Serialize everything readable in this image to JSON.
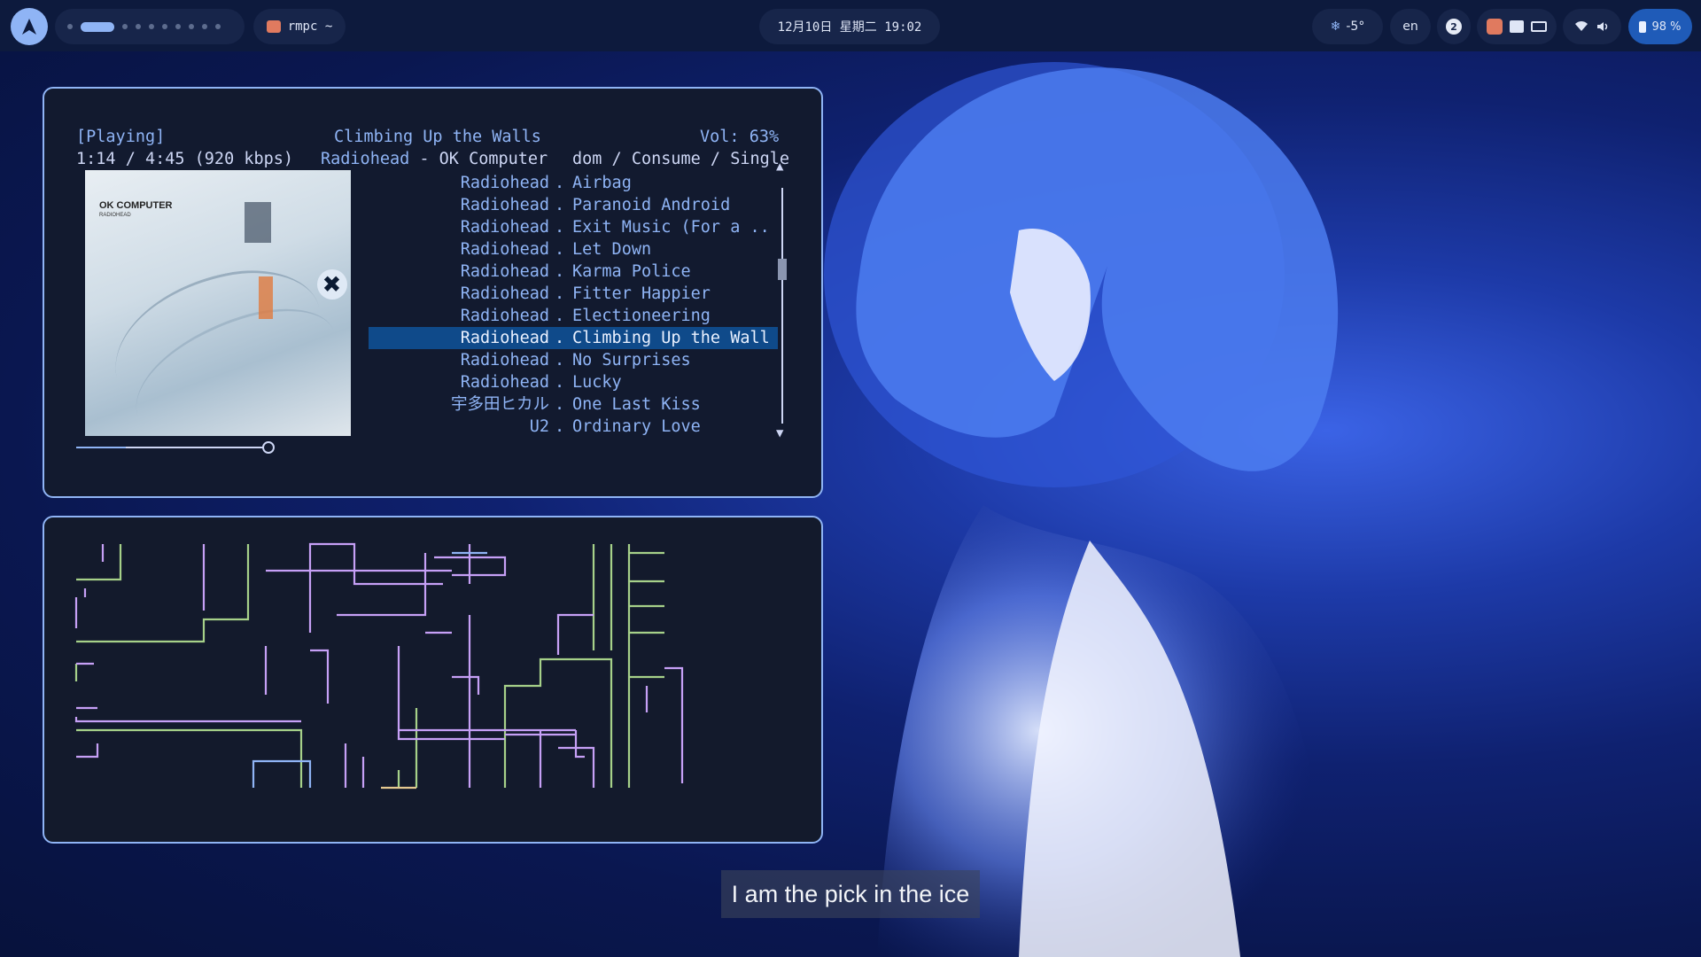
{
  "topbar": {
    "app_label": "rmpc ~",
    "clock": "12月10日 星期二 19:02",
    "weather": "-5°",
    "language": "en",
    "notification_count": "2",
    "battery": "98 %"
  },
  "player": {
    "status": "[Playing]",
    "time": "1:14 / 4:45 (920 kbps)",
    "song_title": "Climbing Up the Walls",
    "artist": "Radiohead",
    "album_sep": " - ",
    "album": "OK Computer",
    "volume": "Vol: 63%",
    "modes": "dom / Consume / Single",
    "cover_title": "OK COMPUTER",
    "cover_artist": "RADIOHEAD",
    "progress": 0.26
  },
  "queue": [
    {
      "artist": "Radiohead",
      "title": "Airbag"
    },
    {
      "artist": "Radiohead",
      "title": "Paranoid Android"
    },
    {
      "artist": "Radiohead",
      "title": "Exit Music (For a .."
    },
    {
      "artist": "Radiohead",
      "title": "Let Down"
    },
    {
      "artist": "Radiohead",
      "title": "Karma Police"
    },
    {
      "artist": "Radiohead",
      "title": "Fitter Happier"
    },
    {
      "artist": "Radiohead",
      "title": "Electioneering"
    },
    {
      "artist": "Radiohead",
      "title": "Climbing Up the Wall",
      "selected": true
    },
    {
      "artist": "Radiohead",
      "title": "No Surprises"
    },
    {
      "artist": "Radiohead",
      "title": "Lucky"
    },
    {
      "artist": "宇多田ヒカル",
      "title": "One Last Kiss"
    },
    {
      "artist": "U2",
      "title": "Ordinary Love"
    }
  ],
  "queue_separator": ".",
  "subtitle": "I am the pick in the ice",
  "colors": {
    "accent": "#8fb4f5",
    "pipe_colors": [
      "#a6d189",
      "#c6a0f6",
      "#8fb4f5",
      "#e5c890",
      "#ca9ee6"
    ]
  }
}
